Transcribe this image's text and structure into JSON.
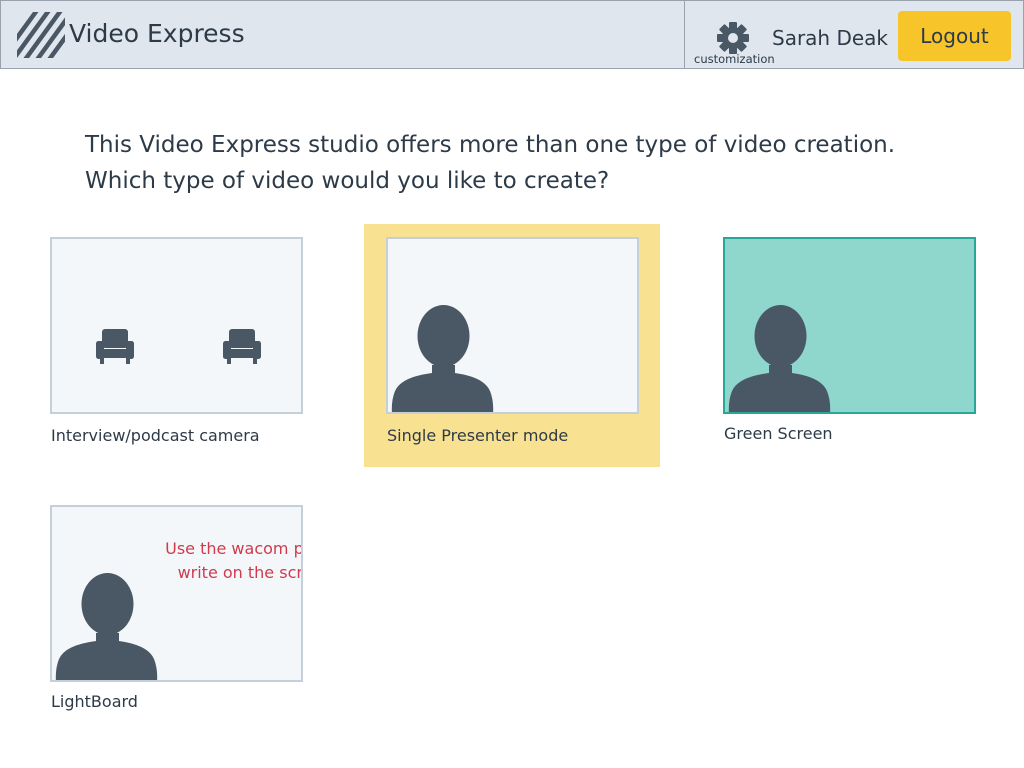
{
  "header": {
    "app_title": "Video Express",
    "settings_label": "customization",
    "user_name": "Sarah Deak",
    "logout_label": "Logout"
  },
  "prompt": {
    "line1": "This Video Express studio offers more than one type of video creation.",
    "line2": "Which type of video would you like to create?"
  },
  "modes": [
    {
      "label": "Interview/podcast camera",
      "selected": false
    },
    {
      "label": "Single Presenter mode",
      "selected": true
    },
    {
      "label": "Green Screen",
      "selected": false
    },
    {
      "label": "LightBoard",
      "selected": false,
      "hint": [
        "Use the wacom pen to",
        "write on the screen"
      ]
    }
  ],
  "colors": {
    "header_bg": "#e0e6ee",
    "accent_yellow": "#f7c42a",
    "selected_highlight": "#f8e190",
    "green_screen": "#8fd6cd",
    "silhouette": "#4a5866",
    "hint_text": "#cf3b4d"
  },
  "icons": [
    "logo-stripes-icon",
    "gear-icon",
    "armchair-icon",
    "person-silhouette-icon"
  ]
}
